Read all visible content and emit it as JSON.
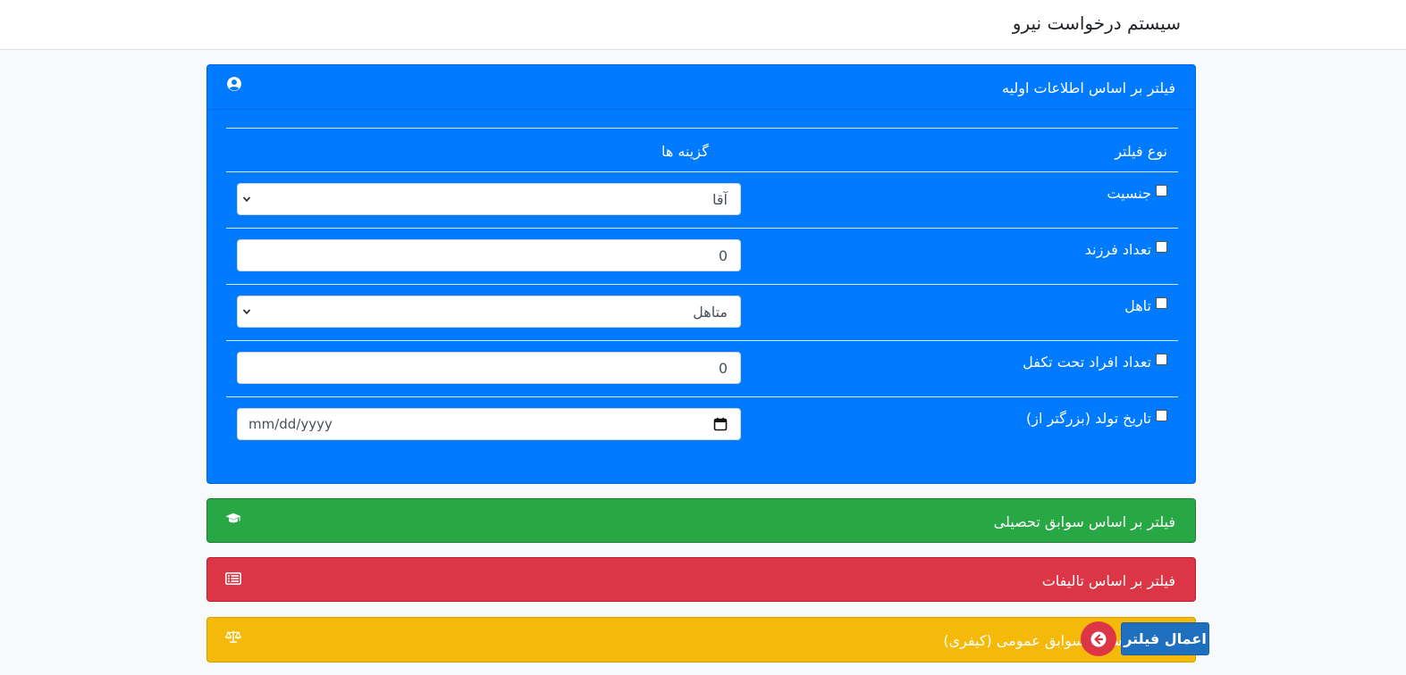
{
  "app": {
    "title": "سیستم درخواست نیرو"
  },
  "cards": {
    "basic": {
      "title": "فیلتر بر اساس اطلاعات اولیه",
      "icon": "user-circle-icon",
      "color": "#007bff",
      "table": {
        "col_type": "نوع فیلتر",
        "col_options": "گزینه ها",
        "rows": [
          {
            "label": "جنسیت",
            "control": "select",
            "value": "آقا",
            "checked": false
          },
          {
            "label": "تعداد فرزند",
            "control": "number",
            "value": "0",
            "checked": false
          },
          {
            "label": "تاهل",
            "control": "select",
            "value": "متاهل",
            "checked": false
          },
          {
            "label": "تعداد افراد تحت تکفل",
            "control": "number",
            "value": "0",
            "checked": false
          },
          {
            "label": "تاریخ تولد (بزرگتر از)",
            "control": "date",
            "value": "mm/dd/yyyy",
            "checked": false
          }
        ]
      }
    },
    "education": {
      "title": "فیلتر بر اساس سوابق تحصیلی",
      "icon": "graduation-cap-icon",
      "color": "#28a745"
    },
    "publications": {
      "title": "فیلتر بر اساس تالیفات",
      "icon": "list-alt-icon",
      "color": "#dc3545"
    },
    "general": {
      "title": "فیلتر بر اساس سوابق عمومی (کیفری)",
      "icon": "balance-scale-icon",
      "color": "#f5b90a"
    }
  },
  "actions": {
    "apply_label": "اعمال فیلتر",
    "back_icon": "arrow-circle-left-icon"
  }
}
